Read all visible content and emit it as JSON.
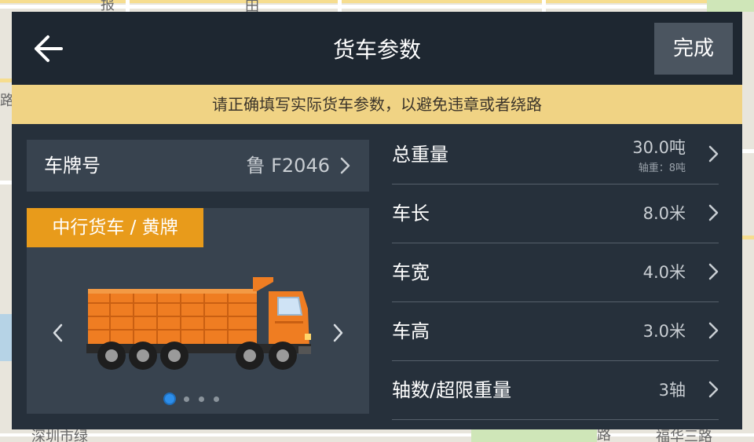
{
  "map": {
    "labels": [
      "报",
      "田",
      "路",
      "深圳市绿",
      "路",
      "福华三路"
    ]
  },
  "header": {
    "back_icon": "arrow-left-icon",
    "title": "货车参数",
    "done_label": "完成"
  },
  "notice": "请正确填写实际货车参数，以避免违章或者绕路",
  "plate": {
    "label": "车牌号",
    "value": "鲁 F2046"
  },
  "truck": {
    "type_label": "中行货车 / 黄牌",
    "color": "#ef7d22",
    "carousel": {
      "total": 4,
      "active": 0
    }
  },
  "params": [
    {
      "label": "总重量",
      "value": "30.0吨",
      "sub": "轴重：8吨"
    },
    {
      "label": "车长",
      "value": "8.0米"
    },
    {
      "label": "车宽",
      "value": "4.0米"
    },
    {
      "label": "车高",
      "value": "3.0米"
    },
    {
      "label": "轴数/超限重量",
      "value": "3轴"
    }
  ],
  "colors": {
    "header_bg": "#1e2731",
    "panel_bg": "#26303b",
    "notice_bg": "#f0d384",
    "badge_bg": "#e89b1b",
    "active_dot": "#2d8eea"
  }
}
